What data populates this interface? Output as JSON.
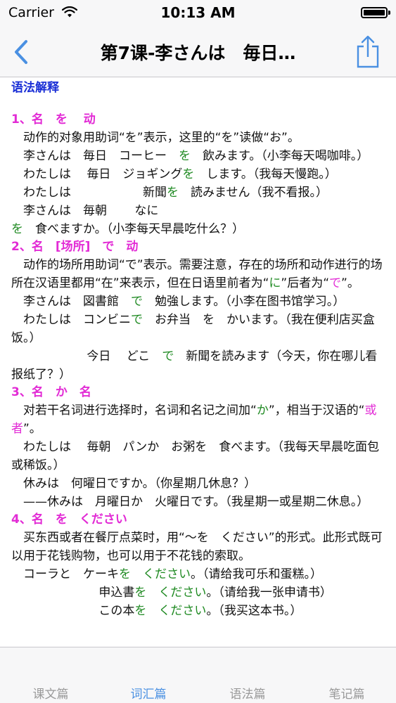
{
  "status": {
    "carrier": "Carrier",
    "time": "10:13 AM"
  },
  "nav": {
    "title": "第7课-李さんは　毎日…"
  },
  "section_title": "语法解释",
  "sections": [
    {
      "heading": "1、名　を　 动",
      "paras": [
        [
          {
            "t": "　动作的对象用助词“を”表示，这里的“を”读做“お”。"
          }
        ],
        [
          {
            "t": "　李さんは　毎日　コーヒー　"
          },
          {
            "t": "を",
            "c": "g"
          },
          {
            "t": "　飲みます。（小李每天喝咖啡。）"
          }
        ],
        [
          {
            "t": "　わたしは　 毎日　ジョギング"
          },
          {
            "t": "を",
            "c": "g"
          },
          {
            "t": "　します。（我每天慢跑。）"
          }
        ],
        [
          {
            "t": "　わたしは　　　　　　新聞"
          },
          {
            "t": "を",
            "c": "g"
          },
          {
            "t": "　読みません（我不看报。）"
          }
        ],
        [
          {
            "t": "　李さんは　毎朝　　 なに"
          },
          {
            "t": "を",
            "c": "g"
          },
          {
            "t": "　食べますか。（小李每天早晨吃什么？）"
          }
        ]
      ]
    },
    {
      "heading": "2、名　[场所]　で　动",
      "paras": [
        [
          {
            "t": "　动作的场所用助词“で”表示。需要注意，存在的场所和动作进行的场所在汉语里都用“在”来表示，但在日语里前者为“"
          },
          {
            "t": "に",
            "c": "g"
          },
          {
            "t": "”后者为“"
          },
          {
            "t": "で",
            "c": "m"
          },
          {
            "t": "”。"
          }
        ],
        [
          {
            "t": "　李さんは　図書館　"
          },
          {
            "t": "で",
            "c": "g"
          },
          {
            "t": "　勉強します。（小李在图书馆学习。）"
          }
        ],
        [
          {
            "t": "　わたしは　コンビニ"
          },
          {
            "t": "で",
            "c": "g"
          },
          {
            "t": "　お弁当　を　かいます。（我在便利店买盒饭。）"
          }
        ],
        [
          {
            "t": "　　　　　　 今日　 どこ　"
          },
          {
            "t": "で",
            "c": "g"
          },
          {
            "t": "　新聞を読みます（今天，你在哪儿看报纸了？）"
          }
        ]
      ]
    },
    {
      "heading": "3、名　か　名",
      "paras": [
        [
          {
            "t": "　对若干名词进行选择时，名词和名记之间加“"
          },
          {
            "t": "か",
            "c": "g"
          },
          {
            "t": "”，相当于汉语的“"
          },
          {
            "t": "或者",
            "c": "m"
          },
          {
            "t": "”。"
          }
        ],
        [
          {
            "t": "　わたしは　 毎朝　パンか　お粥を　食べます。（我每天早晨吃面包或稀饭。）"
          }
        ],
        [
          {
            "t": "　休みは　何曜日ですか。（你星期几休息？）"
          }
        ],
        [
          {
            "t": "　——休みは　月曜日か　火曜日です。（我星期一或星期二休息。）"
          }
        ]
      ]
    },
    {
      "heading": "4、名　を　ください",
      "paras": [
        [
          {
            "t": "　买东西或者在餐厅点菜时，用“～を　ください”的形式。此形式既可以用于花钱购物，也可以用于不花钱的索取。"
          }
        ],
        [
          {
            "t": "　コーラと　ケーキ"
          },
          {
            "t": "を　ください",
            "c": "g"
          },
          {
            "t": "。（请给我可乐和蛋糕。）"
          }
        ],
        [
          {
            "t": "　　　　　　　 申込書"
          },
          {
            "t": "を　ください",
            "c": "g"
          },
          {
            "t": "。（请给我一张申请书）"
          }
        ],
        [
          {
            "t": "　　　　　　　 この本"
          },
          {
            "t": "を　ください",
            "c": "g"
          },
          {
            "t": "。（我买这本书。）"
          }
        ]
      ]
    }
  ],
  "tabs": [
    {
      "label": "课文篇",
      "selected": false
    },
    {
      "label": "词汇篇",
      "selected": true
    },
    {
      "label": "语法篇",
      "selected": false
    },
    {
      "label": "笔记篇",
      "selected": false
    }
  ],
  "colors": {
    "heading_blue": "#1a2fd6",
    "pattern_magenta": "#e22bd5",
    "particle_green": "#1f8a22",
    "tint": "#4a90e2"
  },
  "icons": {
    "back": "chevron-left-icon",
    "share": "share-icon",
    "wifi": "wifi-icon",
    "battery": "battery-icon"
  }
}
